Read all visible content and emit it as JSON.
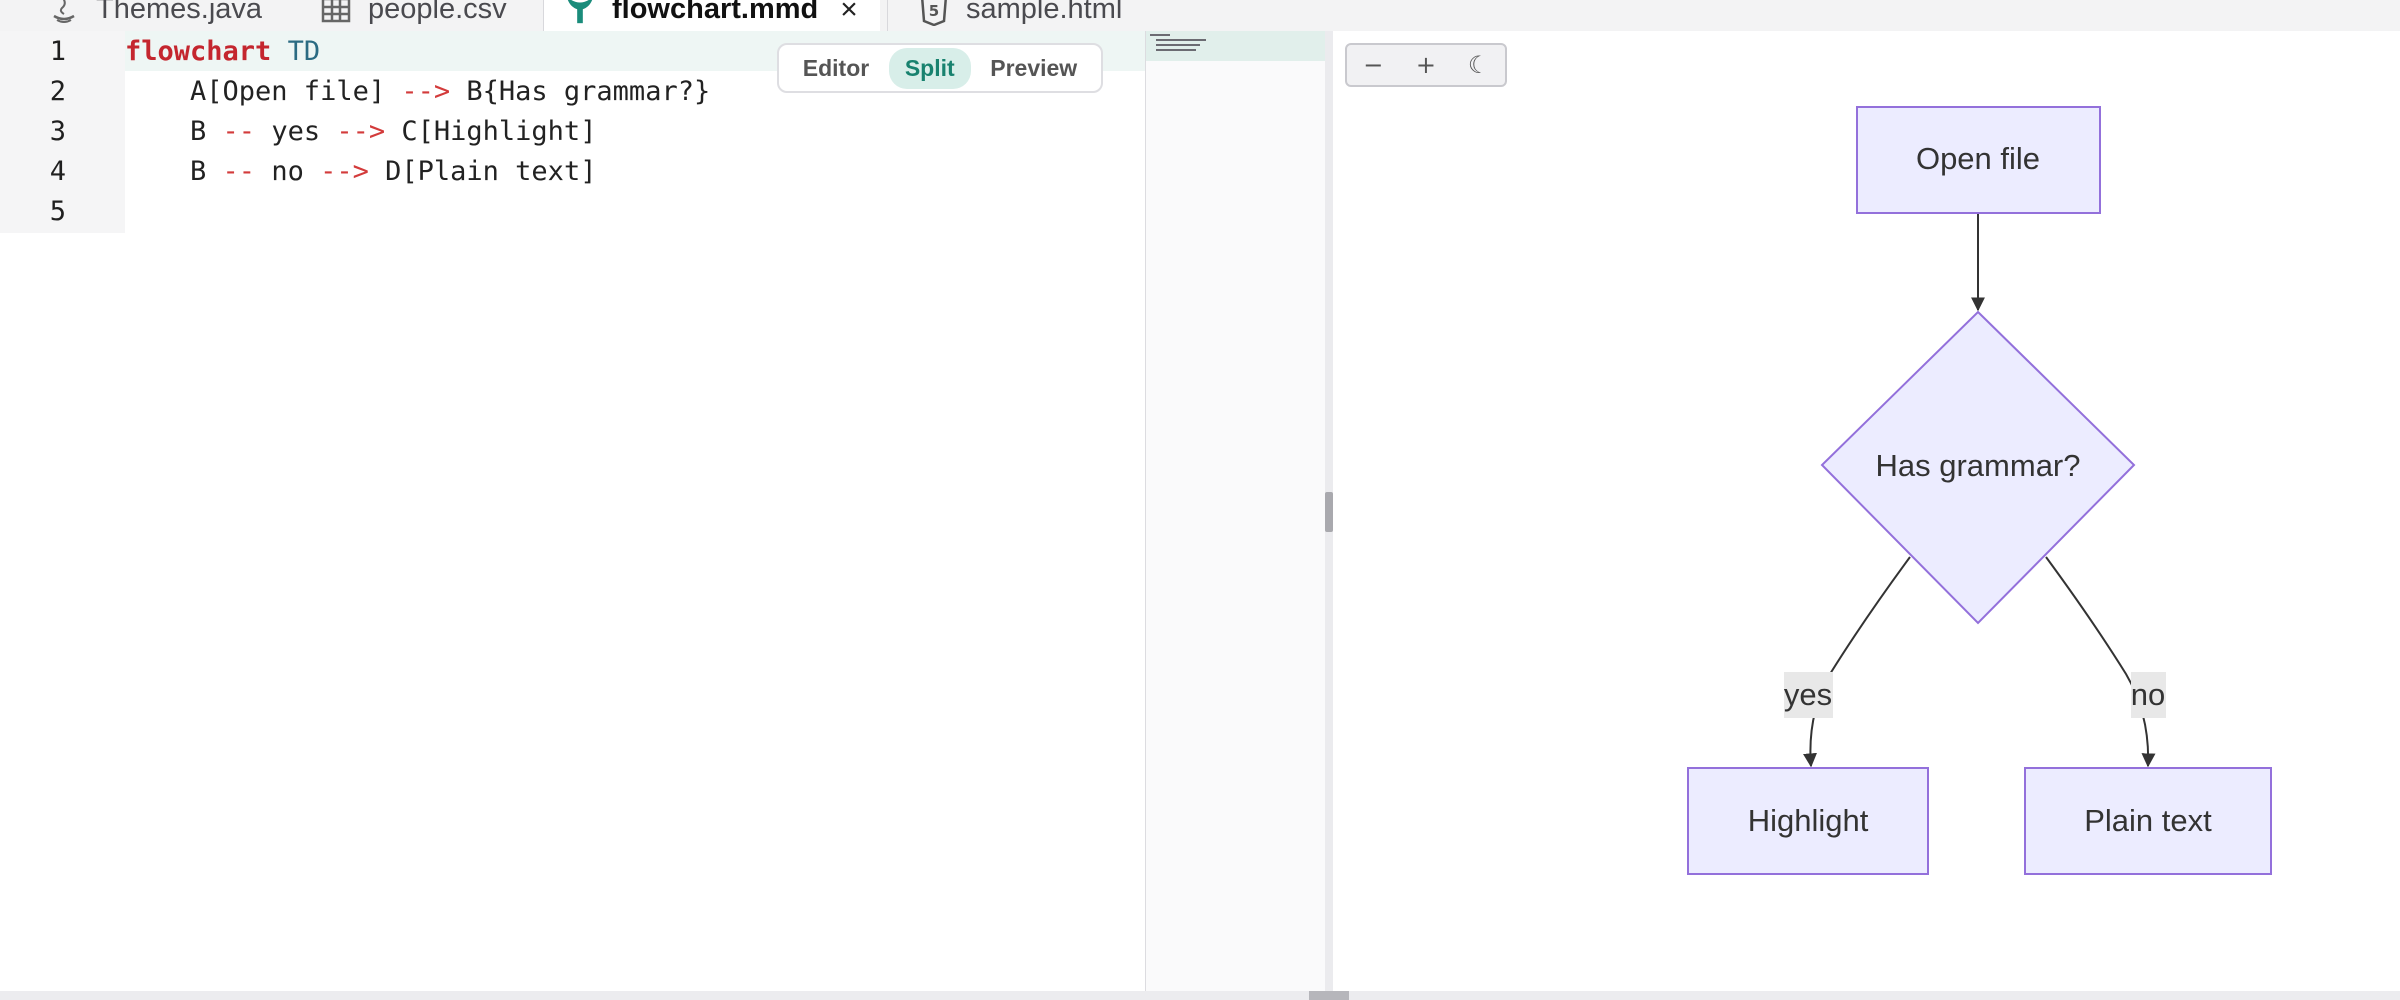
{
  "tabs": [
    {
      "label": "Themes.java",
      "icon": "java-icon",
      "active": false
    },
    {
      "label": "people.csv",
      "icon": "table-icon",
      "active": false
    },
    {
      "label": "flowchart.mmd",
      "icon": "mermaid-icon",
      "active": true,
      "close": "×"
    },
    {
      "label": "sample.html",
      "icon": "html5-icon",
      "active": false
    }
  ],
  "editor": {
    "line_numbers": [
      "1",
      "2",
      "3",
      "4",
      "5"
    ],
    "lines": {
      "l1_kw": "flowchart",
      "l1_dir": "TD",
      "l2_a": "    A[Open file] ",
      "l2_arrow": "-->",
      "l2_b": " B{Has grammar?}",
      "l3_a": "    B ",
      "l3_dash": "--",
      "l3_b": " yes ",
      "l3_arrow": "-->",
      "l3_c": " C[Highlight]",
      "l4_a": "    B ",
      "l4_dash": "--",
      "l4_b": " no ",
      "l4_arrow": "-->",
      "l4_c": " D[Plain text]"
    },
    "view_toggle": {
      "editor": "Editor",
      "split": "Split",
      "preview": "Preview",
      "selected": "Split"
    }
  },
  "preview": {
    "zoom_out": "−",
    "zoom_in": "+",
    "theme_toggle": "☾",
    "nodes": {
      "a": "Open file",
      "b": "Has grammar?",
      "c": "Highlight",
      "d": "Plain text"
    },
    "edges": {
      "yes": "yes",
      "no": "no"
    }
  },
  "colors": {
    "accent": "#18826f",
    "node_fill": "#ececff",
    "node_stroke": "#9370db",
    "keyword": "#c4262e",
    "arrow": "#d33b3b"
  }
}
